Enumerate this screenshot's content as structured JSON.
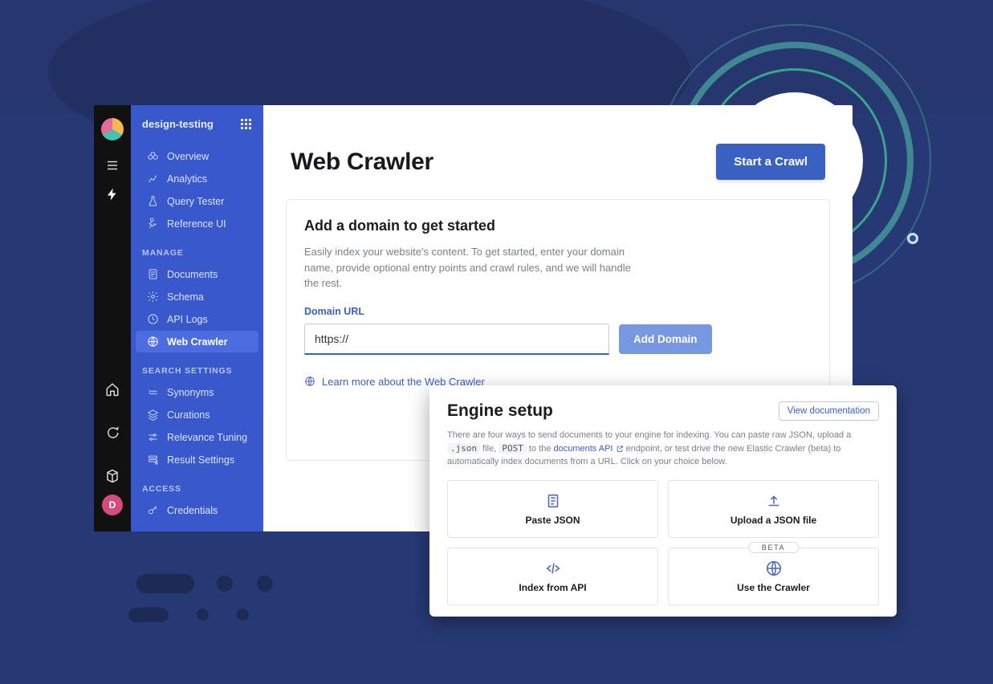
{
  "rail": {
    "avatar_initial": "D"
  },
  "sidebar": {
    "project_name": "design-testing",
    "top_items": [
      {
        "label": "Overview"
      },
      {
        "label": "Analytics"
      },
      {
        "label": "Query Tester"
      },
      {
        "label": "Reference UI"
      }
    ],
    "section_manage": "MANAGE",
    "manage_items": [
      {
        "label": "Documents"
      },
      {
        "label": "Schema"
      },
      {
        "label": "API Logs"
      },
      {
        "label": "Web Crawler"
      }
    ],
    "section_search": "SEARCH SETTINGS",
    "search_items": [
      {
        "label": "Synonyms"
      },
      {
        "label": "Curations"
      },
      {
        "label": "Relevance Tuning"
      },
      {
        "label": "Result Settings"
      }
    ],
    "section_access": "ACCESS",
    "access_items": [
      {
        "label": "Credentials"
      }
    ]
  },
  "main": {
    "title": "Web Crawler",
    "start_crawl_label": "Start a Crawl",
    "card": {
      "heading": "Add a domain to get started",
      "description": "Easily index your website's content. To get started, enter your domain name, provide optional entry points and crawl rules, and we will handle the rest.",
      "field_label": "Domain URL",
      "input_value": "https://",
      "input_placeholder": "",
      "add_domain_label": "Add Domain",
      "learn_more_label": "Learn more about the Web Crawler"
    }
  },
  "engine": {
    "heading": "Engine setup",
    "view_doc_label": "View documentation",
    "desc_parts": {
      "p1": "There are four ways to send documents to your engine for indexing. You can paste raw JSON, upload a ",
      "code1": ".json",
      "p2": " file, ",
      "code2": "POST",
      "p3": " to the ",
      "link": "documents API",
      "p4": " endpoint, or test drive the new Elastic Crawler (beta) to automatically index documents from a URL. Click on your choice below."
    },
    "tiles": [
      {
        "label": "Paste JSON"
      },
      {
        "label": "Upload a JSON file"
      },
      {
        "label": "Index from API"
      },
      {
        "label": "Use the Crawler",
        "badge": "BETA"
      }
    ]
  }
}
